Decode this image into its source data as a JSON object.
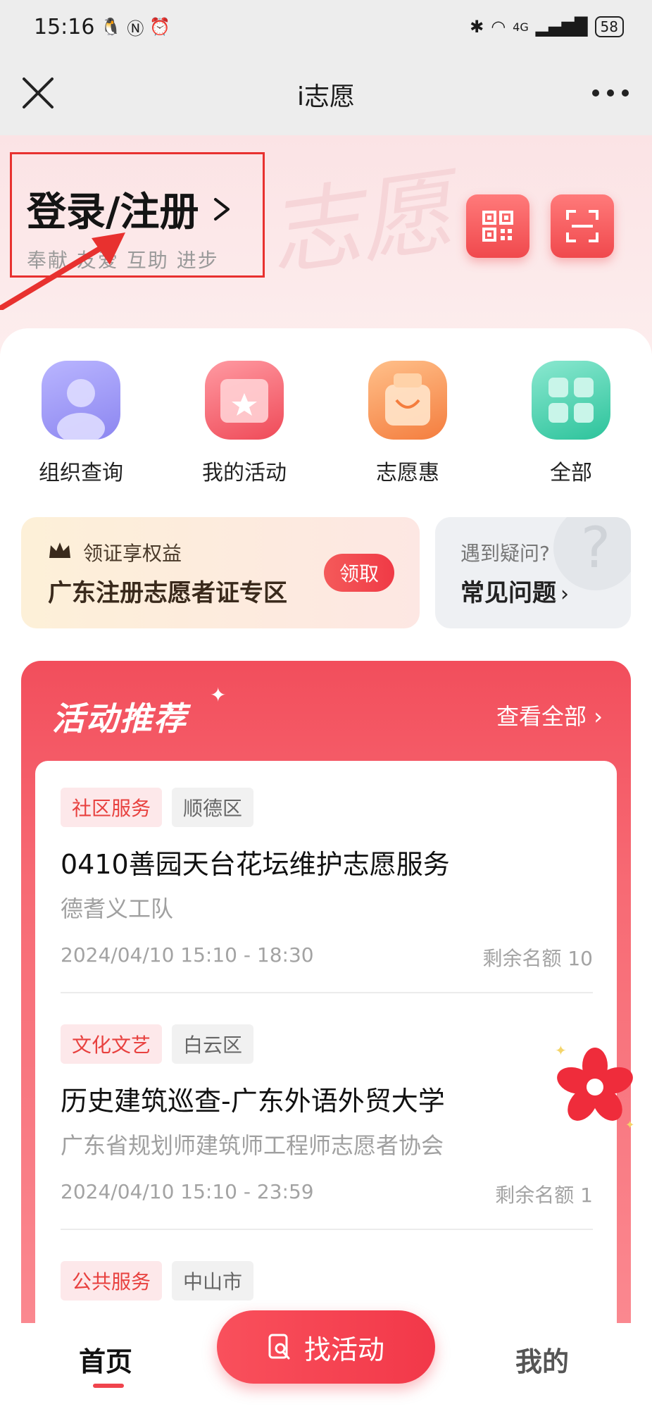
{
  "status_bar": {
    "time": "15:16",
    "battery": "58",
    "network": "4G"
  },
  "header": {
    "title": "i志愿"
  },
  "hero": {
    "login_label": "登录/注册",
    "slogan": "奉献 友爱 互助 进步",
    "watermark": "志愿"
  },
  "quick_links": [
    {
      "label": "组织查询",
      "icon": "people-icon"
    },
    {
      "label": "我的活动",
      "icon": "calendar-icon"
    },
    {
      "label": "志愿惠",
      "icon": "shopping-bag-icon"
    },
    {
      "label": "全部",
      "icon": "grid-icon"
    }
  ],
  "cert_banner": {
    "subtitle": "领证享权益",
    "title": "广东注册志愿者证专区",
    "button": "领取"
  },
  "faq_banner": {
    "subtitle": "遇到疑问?",
    "title": "常见问题"
  },
  "recommend": {
    "title": "活动推荐",
    "view_all": "查看全部",
    "items": [
      {
        "category": "社区服务",
        "area": "顺德区",
        "title": "0410善园天台花坛维护志愿服务",
        "org": "德耆义工队",
        "time": "2024/04/10 15:10 - 18:30",
        "quota": "剩余名额 10"
      },
      {
        "category": "文化文艺",
        "area": "白云区",
        "title": "历史建筑巡查-广东外语外贸大学",
        "org": "广东省规划师建筑师工程师志愿者协会",
        "time": "2024/04/10 15:10 - 23:59",
        "quota": "剩余名额 1"
      },
      {
        "category": "公共服务",
        "area": "中山市"
      }
    ]
  },
  "tab_bar": {
    "home": "首页",
    "find": "找活动",
    "mine": "我的"
  },
  "colors": {
    "accent": "#f23849",
    "annotation": "#e8312f"
  }
}
